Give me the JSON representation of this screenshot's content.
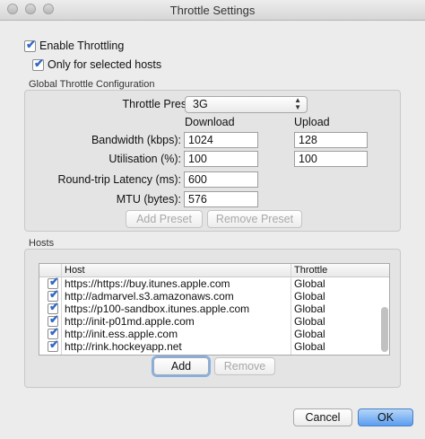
{
  "window": {
    "title": "Throttle Settings"
  },
  "options": {
    "enable_throttling": {
      "label": "Enable Throttling",
      "checked": true
    },
    "only_selected_hosts": {
      "label": "Only for selected hosts",
      "checked": true
    }
  },
  "global": {
    "group_title": "Global Throttle Configuration",
    "preset_label": "Throttle Preset:",
    "preset_value": "3G",
    "col_download": "Download",
    "col_upload": "Upload",
    "bandwidth": {
      "label": "Bandwidth (kbps):",
      "download": "1024",
      "upload": "128"
    },
    "utilisation": {
      "label": "Utilisation (%):",
      "download": "100",
      "upload": "100"
    },
    "latency": {
      "label": "Round-trip Latency (ms):",
      "value": "600"
    },
    "mtu": {
      "label": "MTU (bytes):",
      "value": "576"
    },
    "add_preset": "Add Preset",
    "remove_preset": "Remove Preset"
  },
  "hosts": {
    "group_title": "Hosts",
    "columns": {
      "host": "Host",
      "throttle": "Throttle"
    },
    "rows": [
      {
        "host": "https://https://buy.itunes.apple.com",
        "throttle": "Global",
        "checked": true
      },
      {
        "host": "http://admarvel.s3.amazonaws.com",
        "throttle": "Global",
        "checked": true
      },
      {
        "host": "https://p100-sandbox.itunes.apple.com",
        "throttle": "Global",
        "checked": true
      },
      {
        "host": "http://init-p01md.apple.com",
        "throttle": "Global",
        "checked": true
      },
      {
        "host": "http://init.ess.apple.com",
        "throttle": "Global",
        "checked": true
      },
      {
        "host": "http://rink.hockeyapp.net",
        "throttle": "Global",
        "checked": true
      }
    ],
    "add": "Add",
    "remove": "Remove"
  },
  "footer": {
    "cancel": "Cancel",
    "ok": "OK"
  }
}
